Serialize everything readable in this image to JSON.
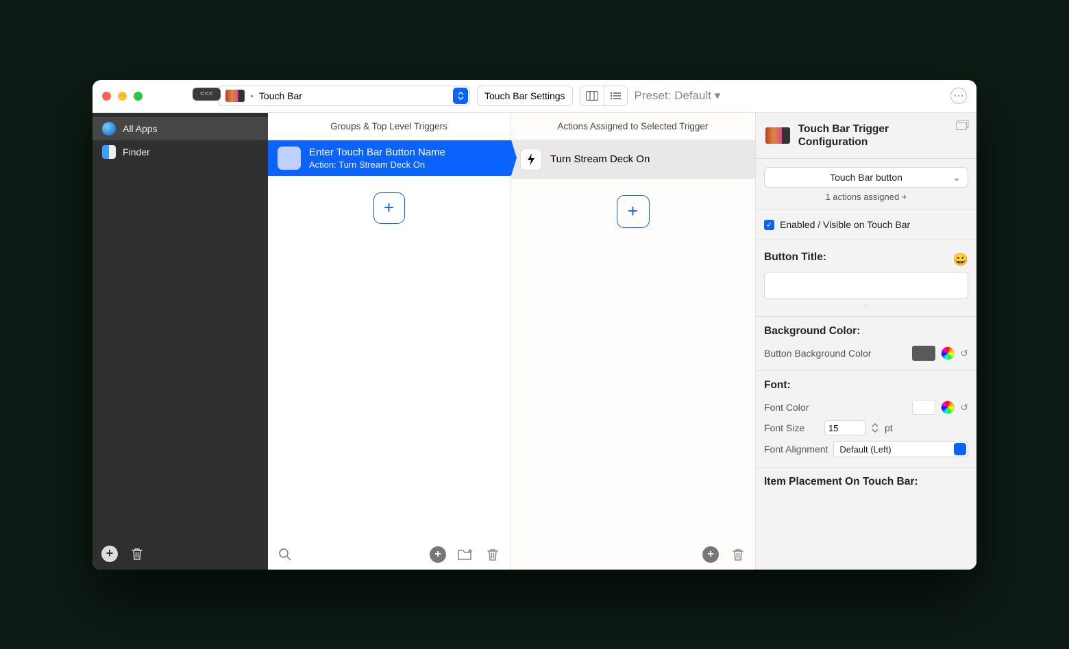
{
  "titlebar": {
    "back_label": "<<<",
    "category_label": "Touch Bar",
    "settings_button": "Touch Bar Settings",
    "preset_label": "Preset: Default ▾"
  },
  "sidebar": {
    "items": [
      {
        "label": "All Apps"
      },
      {
        "label": "Finder"
      }
    ]
  },
  "triggers": {
    "header": "Groups & Top Level Triggers",
    "items": [
      {
        "title": "Enter Touch Bar Button Name",
        "subtitle": "Action: Turn Stream Deck On"
      }
    ]
  },
  "actions": {
    "header": "Actions Assigned to Selected Trigger",
    "items": [
      {
        "label": "Turn Stream Deck On"
      }
    ]
  },
  "config": {
    "title": "Touch Bar Trigger Configuration",
    "type_select": "Touch Bar button",
    "assigned_text": "1 actions assigned +",
    "enabled_label": "Enabled / Visible on Touch Bar",
    "button_title_header": "Button Title:",
    "emoji_button": "😀",
    "bg_header": "Background Color:",
    "bg_label": "Button Background Color",
    "bg_color": "#595959",
    "font_header": "Font:",
    "font_color_label": "Font Color",
    "font_color": "#ffffff",
    "font_size_label": "Font Size",
    "font_size_value": "15",
    "font_size_unit": "pt",
    "align_label": "Font Alignment",
    "align_value": "Default (Left)",
    "placement_header": "Item Placement On Touch Bar:"
  }
}
